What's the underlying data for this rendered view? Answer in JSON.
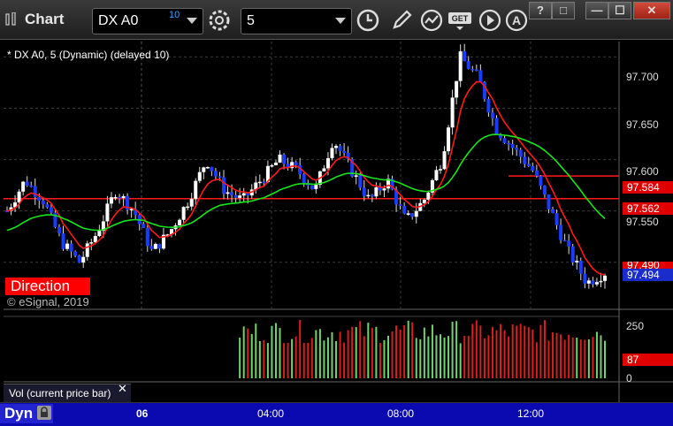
{
  "window": {
    "title": "Chart",
    "symbol": "DX A0",
    "symbol_badge": "10",
    "interval": "5",
    "buttons": [
      "?",
      "□",
      "—",
      "☐",
      "✕"
    ]
  },
  "legend": "* DX A0, 5 (Dynamic) (delayed 10)",
  "direction_label": "Direction",
  "copyright": "© eSignal, 2019",
  "volume_pane": {
    "label": "Vol (current price bar)",
    "close": "✕",
    "axis": [
      "250",
      "87",
      "0"
    ]
  },
  "bottom": {
    "dyn": "Dyn",
    "time_labels": [
      "06",
      "04:00",
      "08:00",
      "12:00"
    ]
  },
  "price_axis": [
    "97.700",
    "97.650",
    "97.600",
    "97.550"
  ],
  "price_tags": {
    "upper_red": "97.584",
    "lower_red": "97.562",
    "ma": "97.490",
    "last": "97.494"
  },
  "colors": {
    "candle_up": "#ffffff",
    "candle_down": "#1a3cff",
    "ma_red": "#ff1a1a",
    "ma_green": "#19e619",
    "vol_red": "#d81e1e",
    "vol_green": "#6fd46f"
  },
  "chart_data": {
    "type": "candlestick",
    "ylim": [
      97.455,
      97.715
    ],
    "x_ticks": [
      "06",
      "04:00",
      "08:00",
      "12:00"
    ],
    "close_path": [
      97.55,
      97.58,
      97.56,
      97.52,
      97.5,
      97.53,
      97.57,
      97.55,
      97.51,
      97.53,
      97.56,
      97.6,
      97.57,
      97.56,
      97.58,
      97.6,
      97.59,
      97.57,
      97.62,
      97.59,
      97.56,
      97.58,
      97.54,
      97.56,
      97.6,
      97.7,
      97.68,
      97.63,
      97.61,
      97.59,
      97.55,
      97.51,
      97.48,
      97.49
    ],
    "levels": [
      97.584,
      97.562
    ]
  }
}
